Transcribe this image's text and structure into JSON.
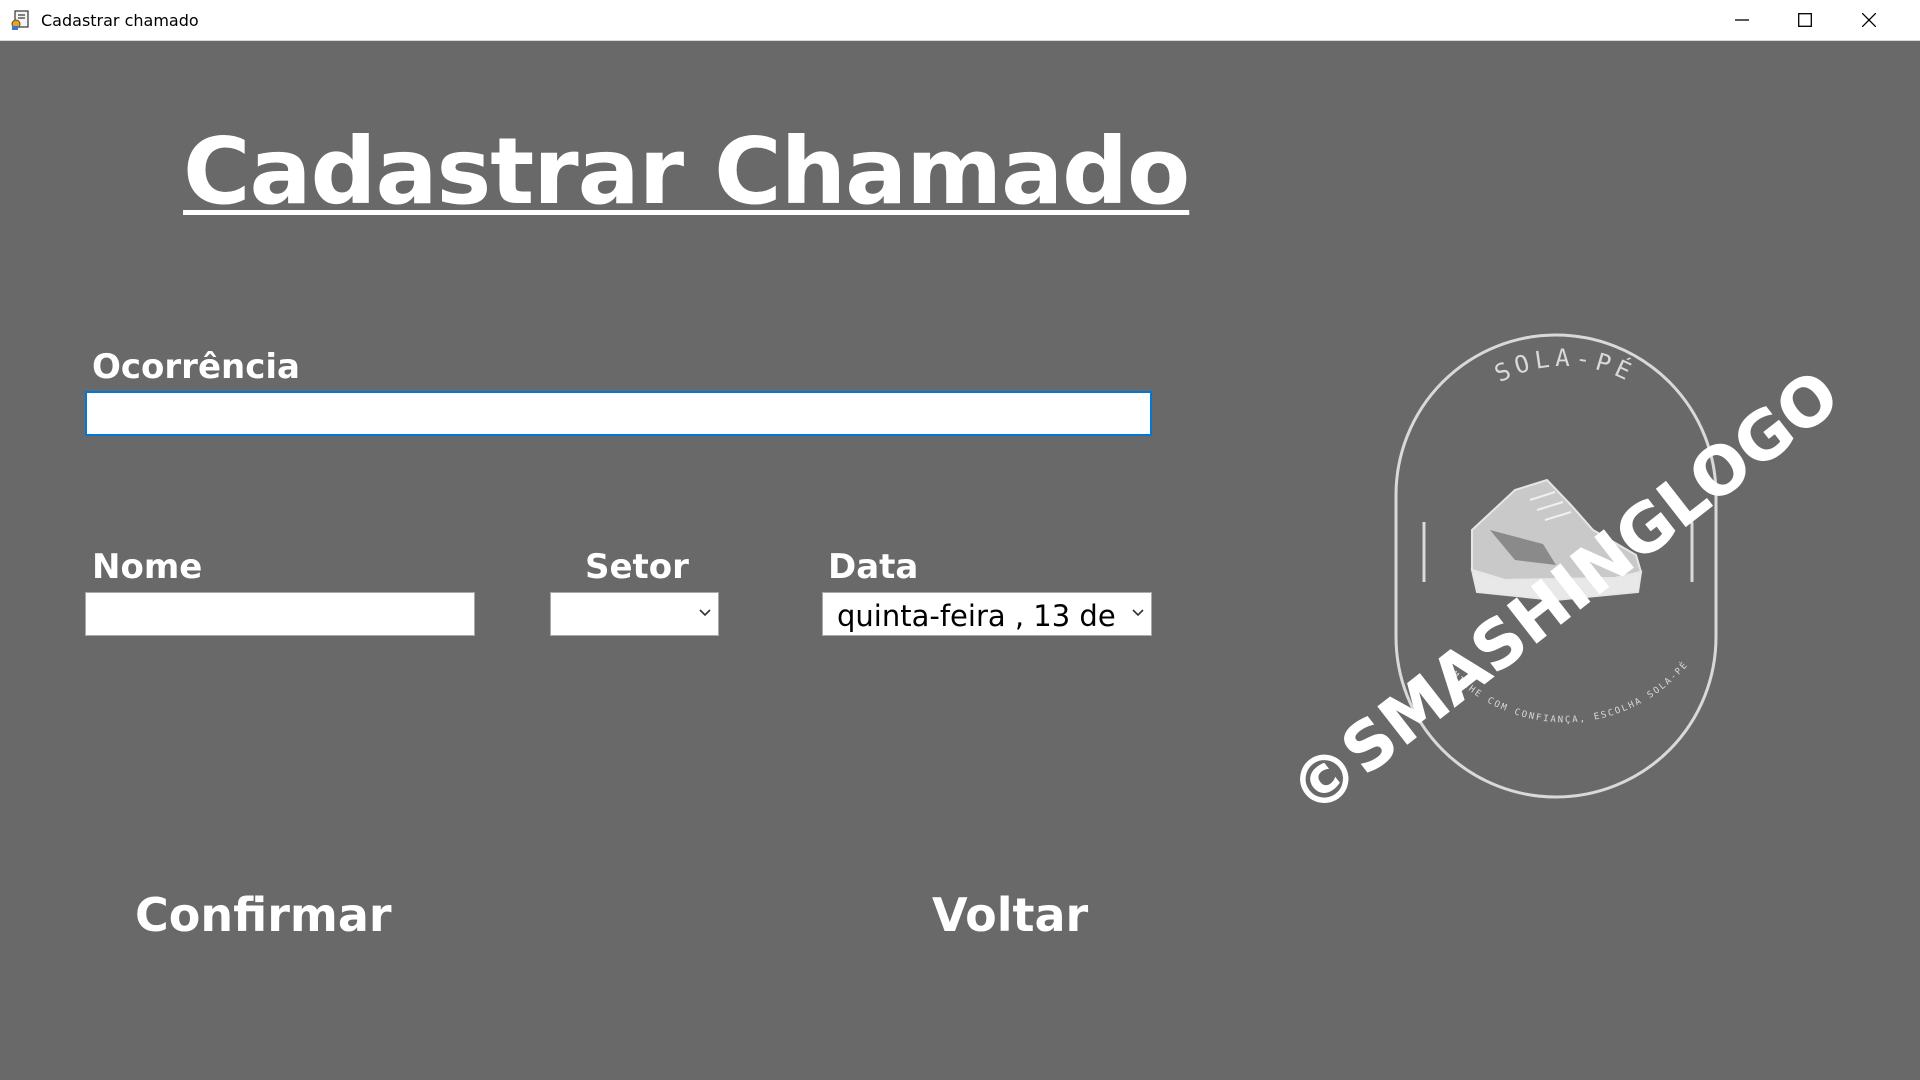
{
  "window": {
    "title": "Cadastrar chamado",
    "icon": "app-form-icon",
    "controls": [
      "minimize-icon",
      "maximize-icon",
      "close-icon"
    ]
  },
  "form": {
    "heading": "Cadastrar Chamado",
    "ocorrencia": {
      "label": "Ocorrência",
      "value": ""
    },
    "nome": {
      "label": "Nome",
      "value": ""
    },
    "setor": {
      "label": "Setor",
      "value": ""
    },
    "data": {
      "label": "Data",
      "value": "quinta-feira  , 13 de"
    }
  },
  "actions": {
    "confirm": "Confirmar",
    "back": "Voltar"
  },
  "logo": {
    "top_text": "SOLA-PÉ",
    "bottom_text": "CAMINHE COM CONFIANÇA, ESCOLHA SOLA-PÉ",
    "watermark": "©SMASHINGLOGO"
  },
  "colors": {
    "background": "#696969",
    "focus_border": "#0078d7",
    "logo_line": "#d9d9d9"
  }
}
